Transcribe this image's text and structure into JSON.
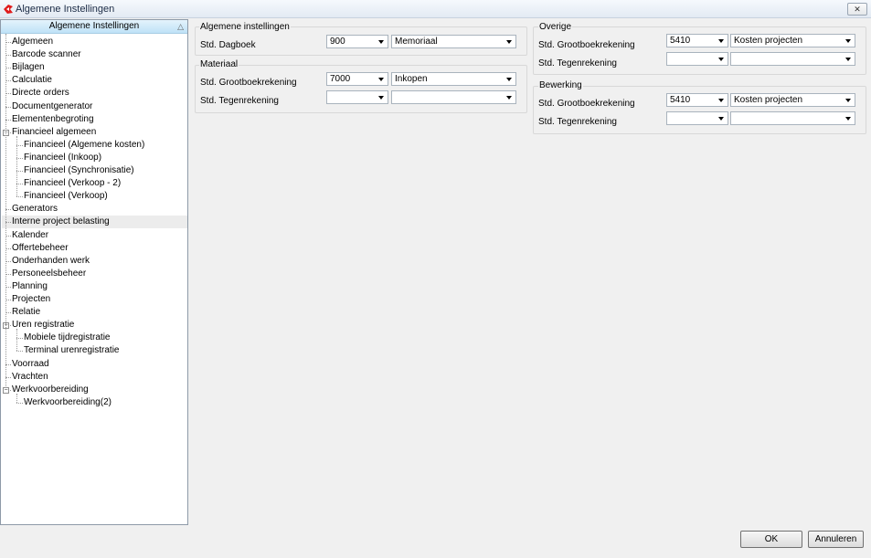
{
  "window": {
    "title": "Algemene Instellingen",
    "close_glyph": "✕"
  },
  "tree": {
    "header": "Algemene Instellingen",
    "items": [
      {
        "label": "Algemeen",
        "level": 0
      },
      {
        "label": "Barcode scanner",
        "level": 0
      },
      {
        "label": "Bijlagen",
        "level": 0
      },
      {
        "label": "Calculatie",
        "level": 0
      },
      {
        "label": "Directe orders",
        "level": 0
      },
      {
        "label": "Documentgenerator",
        "level": 0
      },
      {
        "label": "Elementenbegroting",
        "level": 0
      },
      {
        "label": "Financieel algemeen",
        "level": 0
      },
      {
        "label": "Financieel (Algemene kosten)",
        "level": 1
      },
      {
        "label": "Financieel (Inkoop)",
        "level": 1
      },
      {
        "label": "Financieel (Synchronisatie)",
        "level": 1
      },
      {
        "label": "Financieel (Verkoop - 2)",
        "level": 1
      },
      {
        "label": "Financieel (Verkoop)",
        "level": 1
      },
      {
        "label": "Generators",
        "level": 0
      },
      {
        "label": "Interne project belasting",
        "level": 0
      },
      {
        "label": "Kalender",
        "level": 0
      },
      {
        "label": "Offertebeheer",
        "level": 0
      },
      {
        "label": "Onderhanden werk",
        "level": 0
      },
      {
        "label": "Personeelsbeheer",
        "level": 0
      },
      {
        "label": "Planning",
        "level": 0
      },
      {
        "label": "Projecten",
        "level": 0
      },
      {
        "label": "Relatie",
        "level": 0
      },
      {
        "label": "Uren registratie",
        "level": 0
      },
      {
        "label": "Mobiele tijdregistratie",
        "level": 1
      },
      {
        "label": "Terminal urenregistratie",
        "level": 1
      },
      {
        "label": "Voorraad",
        "level": 0
      },
      {
        "label": "Vrachten",
        "level": 0
      },
      {
        "label": "Werkvoorbereiding",
        "level": 0
      },
      {
        "label": "Werkvoorbereiding(2)",
        "level": 1
      }
    ]
  },
  "groups": {
    "algemeen": {
      "title": "Algemene instellingen",
      "dagboek_label": "Std. Dagboek",
      "dagboek_code": "900",
      "dagboek_name": "Memoriaal"
    },
    "materiaal": {
      "title": "Materiaal",
      "grootboek_label": "Std. Grootboekrekening",
      "grootboek_code": "7000",
      "grootboek_name": "Inkopen",
      "tegen_label": "Std. Tegenrekening",
      "tegen_code": "",
      "tegen_name": ""
    },
    "overige": {
      "title": "Overige",
      "grootboek_label": "Std. Grootboekrekening",
      "grootboek_code": "5410",
      "grootboek_name": "Kosten projecten",
      "tegen_label": "Std. Tegenrekening",
      "tegen_code": "",
      "tegen_name": ""
    },
    "bewerking": {
      "title": "Bewerking",
      "grootboek_label": "Std. Grootboekrekening",
      "grootboek_code": "5410",
      "grootboek_name": "Kosten projecten",
      "tegen_label": "Std. Tegenrekening",
      "tegen_code": "",
      "tegen_name": ""
    }
  },
  "buttons": {
    "ok": "OK",
    "cancel": "Annuleren"
  }
}
